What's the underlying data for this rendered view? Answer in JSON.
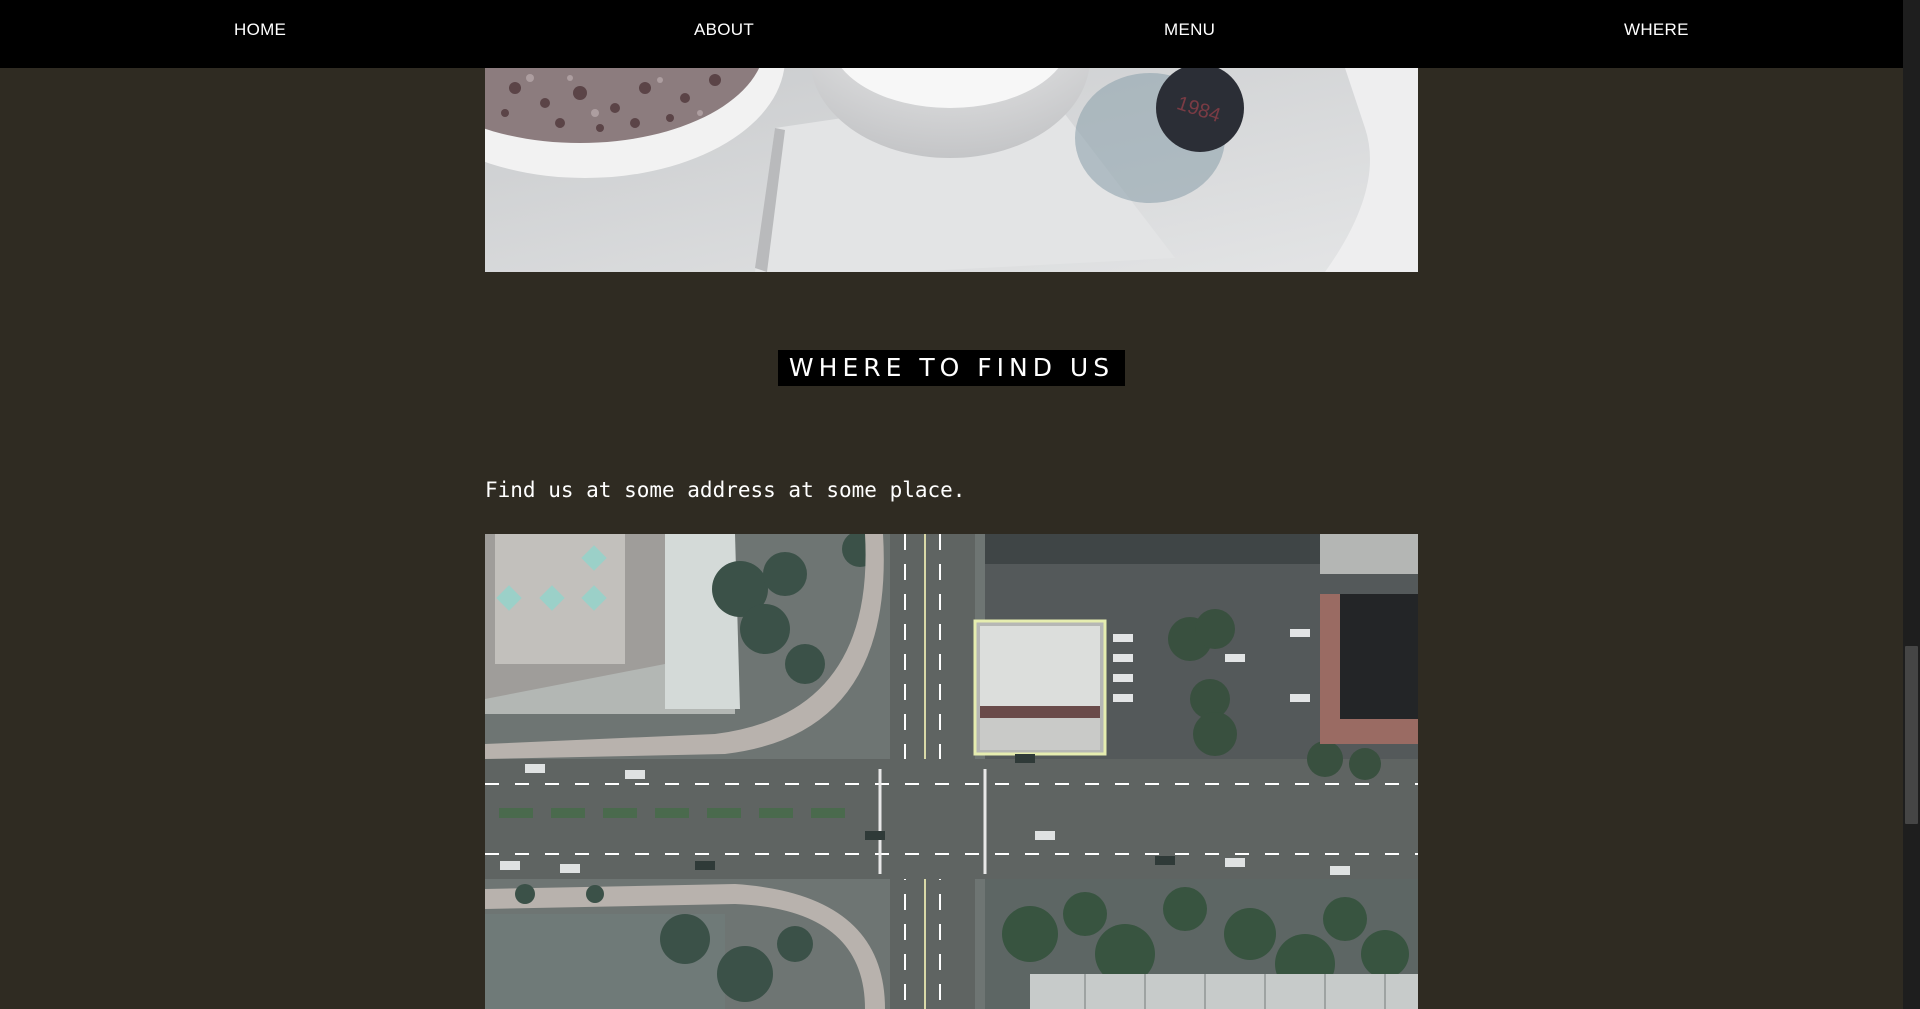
{
  "nav": {
    "items": [
      {
        "label": "HOME"
      },
      {
        "label": "ABOUT"
      },
      {
        "label": "MENU"
      },
      {
        "label": "WHERE"
      }
    ]
  },
  "hero_image": {
    "cup_text": "1984"
  },
  "section": {
    "heading": "WHERE TO FIND US",
    "address": "Find us at some address at some place."
  },
  "colors": {
    "page_bg": "#2f2b22",
    "nav_bg": "#000000",
    "highlight": "#e6edb0"
  }
}
